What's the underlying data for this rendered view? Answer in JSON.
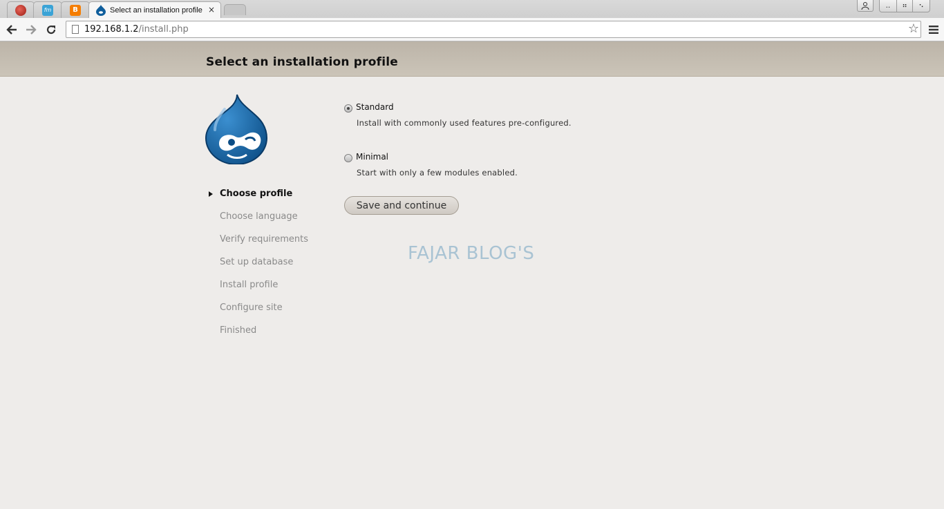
{
  "browser": {
    "tabs": [
      {
        "icon": "opera-icon",
        "color": "#c0392b"
      },
      {
        "icon": "fm-icon",
        "color": "#3aa3d6"
      },
      {
        "icon": "blogger-icon",
        "color": "#f57d00"
      },
      {
        "title": "Select an installation profile",
        "icon": "drupal-icon",
        "close": "×"
      }
    ],
    "url": {
      "host": "192.168.1.2",
      "path": "/install.php"
    }
  },
  "page": {
    "title": "Select an installation profile",
    "steps": [
      {
        "label": "Choose profile",
        "active": true
      },
      {
        "label": "Choose language"
      },
      {
        "label": "Verify requirements"
      },
      {
        "label": "Set up database"
      },
      {
        "label": "Install profile"
      },
      {
        "label": "Configure site"
      },
      {
        "label": "Finished"
      }
    ],
    "profiles": [
      {
        "label": "Standard",
        "description": "Install with commonly used features pre-configured.",
        "checked": true
      },
      {
        "label": "Minimal",
        "description": "Start with only a few modules enabled.",
        "checked": false
      }
    ],
    "save_label": "Save and continue",
    "watermark": "FAJAR BLOG'S"
  },
  "colors": {
    "drupal_blue": "#0f5e9c",
    "header_bg": "#c4bcb0",
    "page_bg": "#eeecea"
  }
}
